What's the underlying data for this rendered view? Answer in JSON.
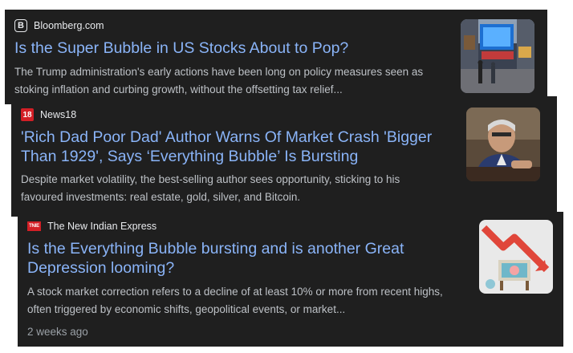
{
  "results": [
    {
      "source": "Bloomberg.com",
      "favicon_glyph": "B",
      "title": "Is the Super Bubble in US Stocks About to Pop?",
      "snippet_line1": "The Trump administration's early actions have been long on policy measures seen as",
      "snippet_line2": "stoking inflation and curbing growth, without the offsetting tax relief...",
      "thumbnail": "times-square-photo"
    },
    {
      "source": "News18",
      "favicon_glyph": "18",
      "title_line1": "'Rich Dad Poor Dad' Author Warns Of Market Crash 'Bigger",
      "title_line2": "Than 1929', Says ‘Everything Bubble’ Is Bursting",
      "snippet_line1": "Despite market volatility, the best-selling author sees opportunity, sticking to his",
      "snippet_line2": "favoured investments: real estate, gold, silver, and Bitcoin.",
      "thumbnail": "author-portrait-photo"
    },
    {
      "source": "The New Indian Express",
      "favicon_glyph": "TNIE",
      "title_line1": "Is the Everything Bubble bursting and is another Great",
      "title_line2": "Depression looming?",
      "snippet_line1": "A stock market correction refers to a decline of at least 10% or more from recent highs,",
      "snippet_line2": "often triggered by economic shifts, geopolitical events, or market...",
      "time": "2 weeks ago",
      "thumbnail": "market-crash-illustration"
    }
  ],
  "colors": {
    "card_bg": "#1f1f1f",
    "title": "#8ab4f8",
    "snippet": "#bdc1c6",
    "meta": "#9aa0a6",
    "brand_red": "#d31f26"
  }
}
